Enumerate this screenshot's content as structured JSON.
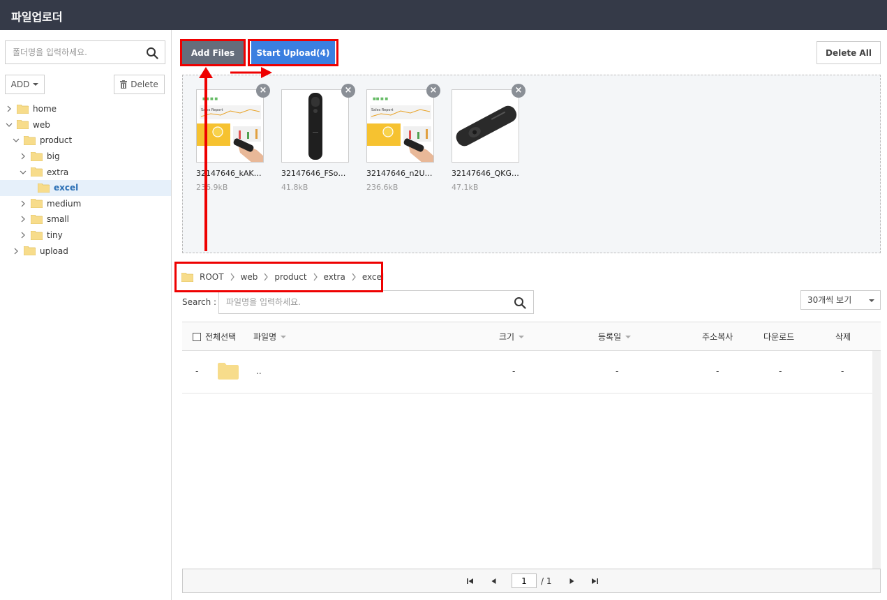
{
  "app": {
    "title": "파일업로더"
  },
  "sidebar": {
    "search_placeholder": "폴더명을 입력하세요.",
    "add_label": "ADD",
    "delete_label": "Delete",
    "tree": [
      {
        "label": "home",
        "depth": 0,
        "expanded": false,
        "selected": false
      },
      {
        "label": "web",
        "depth": 0,
        "expanded": true,
        "selected": false
      },
      {
        "label": "product",
        "depth": 1,
        "expanded": true,
        "selected": false
      },
      {
        "label": "big",
        "depth": 2,
        "expanded": false,
        "selected": false
      },
      {
        "label": "extra",
        "depth": 2,
        "expanded": true,
        "selected": false
      },
      {
        "label": "excel",
        "depth": 3,
        "expanded": null,
        "selected": true
      },
      {
        "label": "medium",
        "depth": 2,
        "expanded": false,
        "selected": false
      },
      {
        "label": "small",
        "depth": 2,
        "expanded": false,
        "selected": false
      },
      {
        "label": "tiny",
        "depth": 2,
        "expanded": false,
        "selected": false
      },
      {
        "label": "upload",
        "depth": 1,
        "expanded": false,
        "selected": false
      }
    ]
  },
  "toolbar": {
    "add_files_label": "Add Files",
    "start_upload_label": "Start Upload(4)",
    "delete_all_label": "Delete All"
  },
  "queue": [
    {
      "name": "32147646_kAKfl…",
      "size": "236.9kB",
      "kind": "chart"
    },
    {
      "name": "32147646_FSon…",
      "size": "41.8kB",
      "kind": "pointer"
    },
    {
      "name": "32147646_n2UH…",
      "size": "236.6kB",
      "kind": "chart"
    },
    {
      "name": "32147646_QKG…",
      "size": "47.1kB",
      "kind": "pointer-angled"
    }
  ],
  "breadcrumb": [
    "ROOT",
    "web",
    "product",
    "extra",
    "excel"
  ],
  "filelist": {
    "search_label": "Search :",
    "search_placeholder": "파일명을 입력하세요.",
    "per_page": "30개씩 보기",
    "columns": {
      "select_all": "전체선택",
      "filename": "파일명",
      "size": "크기",
      "date": "등록일",
      "copy_address": "주소복사",
      "download": "다운로드",
      "delete": "삭제"
    },
    "rows": [
      {
        "index": "-",
        "name": "..",
        "size": "-",
        "date": "-",
        "copy": "-",
        "download": "-",
        "delete": "-"
      }
    ]
  },
  "pagination": {
    "current": "1",
    "total": "/ 1"
  },
  "colors": {
    "header_bg": "#353a48",
    "add_btn": "#656d7b",
    "upload_btn": "#3b7fe0",
    "highlight": "#e00000",
    "folder": "#f7dc8b"
  }
}
